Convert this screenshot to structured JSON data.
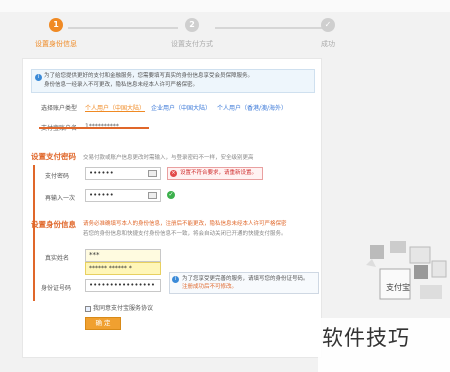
{
  "steps": [
    {
      "num": "1",
      "label": "设置身份信息",
      "active": true
    },
    {
      "num": "2",
      "label": "设置支付方式",
      "active": false
    },
    {
      "num": "✓",
      "label": "成功",
      "active": false
    }
  ],
  "notice": {
    "line1": "为了给您提供更好的支付和金融服务，您需要填写真实的身份信息享受会员保障服务。",
    "line2": "身份信息一经录入不可更改，隐私信息未经本人许可严格保密。"
  },
  "account_type": {
    "label": "选择账户类型",
    "options": [
      "个人用户（中国大陆）",
      "企业用户（中国大陆）",
      "个人用户（香港/澳/海外）"
    ]
  },
  "account_name": {
    "label": "支付宝账户名",
    "value": "1**********"
  },
  "pay_password": {
    "section_title": "设置支付密码",
    "hint": "交易付款或账户信息更改时需输入，与登录密码不一样，安全级别更高",
    "label": "支付密码",
    "value": "••••••",
    "error": "设置不符合要求，请重新设置。",
    "confirm_label": "再输入一次",
    "confirm_value": "••••••"
  },
  "identity": {
    "section_title": "设置身份信息",
    "hint_line1": "请务必准确填写本人的身份信息，注册后不能更改，隐私信息未经本人许可严格保密",
    "hint_line2": "若您的身份信息和快捷支付身份信息不一致，将会自动关闭已开通的快捷支付服务。",
    "name_label": "真实姓名",
    "name_value": "***",
    "name_suggest": "****** ****** *",
    "id_label": "身份证号码",
    "id_value": "••••••••••••••••",
    "tip_line1": "为了您享受更完善的服务，请填写您的身份证号码。",
    "tip_line2": "注册成功后不可修改。",
    "agree": "我同意支付宝服务协议",
    "submit": "确 定"
  },
  "side_panel": {
    "brand": "支付宝"
  },
  "watermark": "软件技巧",
  "colors": {
    "accent": "#f08a24",
    "section": "#e0672a",
    "link": "#3a78d8",
    "error": "#d03030",
    "ok": "#3cb04c"
  }
}
